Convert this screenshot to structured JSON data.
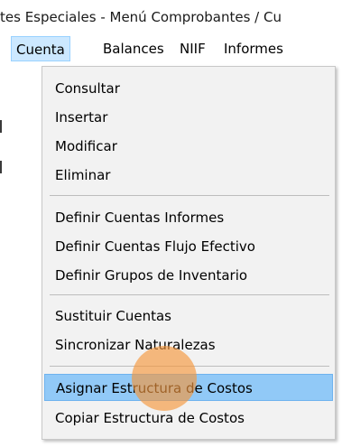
{
  "window": {
    "title": "tes Especiales - Menú Comprobantes / Cu"
  },
  "menubar": {
    "items": [
      {
        "label": "Cuenta",
        "active": true
      },
      {
        "label": "Balances",
        "active": false
      },
      {
        "label": "NIIF",
        "active": false
      },
      {
        "label": "Informes",
        "active": false
      }
    ]
  },
  "dropdown": {
    "items": [
      {
        "label": "Consultar"
      },
      {
        "label": "Insertar"
      },
      {
        "label": "Modificar"
      },
      {
        "label": "Eliminar"
      },
      {
        "label": "Definir Cuentas Informes"
      },
      {
        "label": "Definir Cuentas Flujo Efectivo"
      },
      {
        "label": "Definir Grupos de Inventario"
      },
      {
        "label": "Sustituir Cuentas"
      },
      {
        "label": "Sincronizar Naturalezas"
      },
      {
        "label": "Asignar Estructura de Costos",
        "highlighted": true
      },
      {
        "label": "Copiar Estructura de Costos"
      }
    ]
  },
  "colors": {
    "menu_background": "#f2f2f2",
    "highlight": "#91c9f7",
    "active_menubar": "#cce8ff",
    "cursor_marker": "#f4963c"
  }
}
